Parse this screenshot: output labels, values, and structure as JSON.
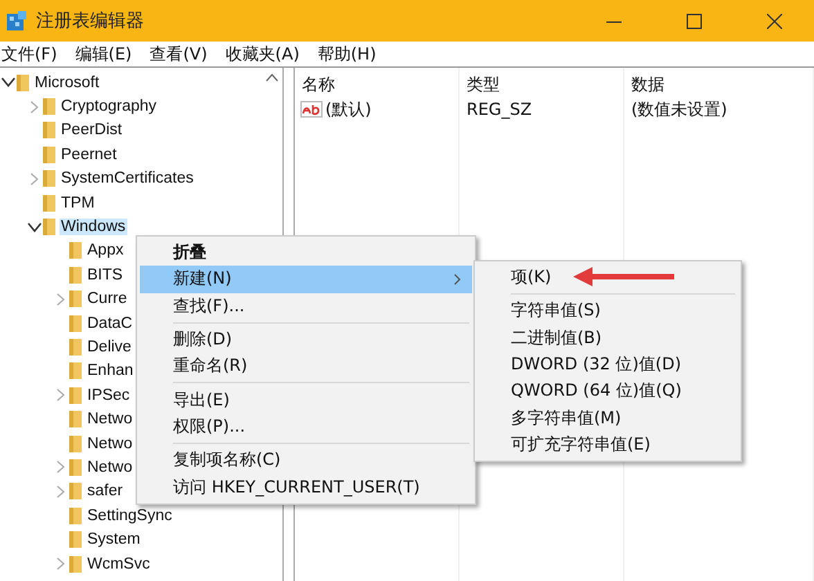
{
  "window": {
    "title": "注册表编辑器"
  },
  "menu_bar": [
    "文件(F)",
    "编辑(E)",
    "查看(V)",
    "收藏夹(A)",
    "帮助(H)"
  ],
  "tree": [
    {
      "label": "Microsoft",
      "expanded": true,
      "selected": false,
      "children": [
        {
          "label": "Cryptography",
          "expanded": false,
          "selected": false
        },
        {
          "label": "PeerDist",
          "selected": false
        },
        {
          "label": "Peernet",
          "selected": false
        },
        {
          "label": "SystemCertificates",
          "expanded": false,
          "selected": false
        },
        {
          "label": "TPM",
          "selected": false
        },
        {
          "label": "Windows",
          "expanded": true,
          "selected": true,
          "children": [
            {
              "label": "Appx",
              "selected": false
            },
            {
              "label": "BITS",
              "selected": false
            },
            {
              "label": "Curre",
              "expanded": false,
              "selected": false
            },
            {
              "label": "DataC",
              "selected": false
            },
            {
              "label": "Delive",
              "selected": false
            },
            {
              "label": "Enhan",
              "selected": false
            },
            {
              "label": "IPSec",
              "expanded": false,
              "selected": false
            },
            {
              "label": "Netwo",
              "selected": false
            },
            {
              "label": "Netwo",
              "selected": false
            },
            {
              "label": "Netwo",
              "expanded": false,
              "selected": false
            },
            {
              "label": "safer",
              "expanded": false,
              "selected": false
            },
            {
              "label": "SettingSync",
              "selected": false
            },
            {
              "label": "System",
              "selected": false
            },
            {
              "label": "WcmSvc",
              "expanded": false,
              "selected": false
            }
          ]
        }
      ]
    }
  ],
  "list": {
    "columns": [
      "名称",
      "类型",
      "数据"
    ],
    "rows": [
      {
        "name": "(默认)",
        "type": "REG_SZ",
        "data": "(数值未设置)"
      }
    ]
  },
  "context_menu": [
    {
      "kind": "item",
      "label": "折叠",
      "bold": true,
      "selected": false,
      "submenu": false
    },
    {
      "kind": "item",
      "label": "新建(N)",
      "bold": false,
      "selected": true,
      "submenu": true
    },
    {
      "kind": "item",
      "label": "查找(F)...",
      "bold": false,
      "selected": false,
      "submenu": false
    },
    {
      "kind": "separator"
    },
    {
      "kind": "item",
      "label": "删除(D)",
      "bold": false,
      "selected": false,
      "submenu": false
    },
    {
      "kind": "item",
      "label": "重命名(R)",
      "bold": false,
      "selected": false,
      "submenu": false
    },
    {
      "kind": "separator"
    },
    {
      "kind": "item",
      "label": "导出(E)",
      "bold": false,
      "selected": false,
      "submenu": false
    },
    {
      "kind": "item",
      "label": "权限(P)...",
      "bold": false,
      "selected": false,
      "submenu": false
    },
    {
      "kind": "separator"
    },
    {
      "kind": "item",
      "label": "复制项名称(C)",
      "bold": false,
      "selected": false,
      "submenu": false
    },
    {
      "kind": "item",
      "label": "访问 HKEY_CURRENT_USER(T)",
      "bold": false,
      "selected": false,
      "submenu": false
    }
  ],
  "submenu": [
    {
      "kind": "item",
      "label": "项(K)",
      "bold": false,
      "selected": false,
      "submenu": false
    },
    {
      "kind": "separator"
    },
    {
      "kind": "item",
      "label": "字符串值(S)",
      "bold": false,
      "selected": false,
      "submenu": false
    },
    {
      "kind": "item",
      "label": "二进制值(B)",
      "bold": false,
      "selected": false,
      "submenu": false
    },
    {
      "kind": "item",
      "label": "DWORD (32 位)值(D)",
      "bold": false,
      "selected": false,
      "submenu": false
    },
    {
      "kind": "item",
      "label": "QWORD (64 位)值(Q)",
      "bold": false,
      "selected": false,
      "submenu": false
    },
    {
      "kind": "item",
      "label": "多字符串值(M)",
      "bold": false,
      "selected": false,
      "submenu": false
    },
    {
      "kind": "item",
      "label": "可扩充字符串值(E)",
      "bold": false,
      "selected": false,
      "submenu": false
    }
  ]
}
